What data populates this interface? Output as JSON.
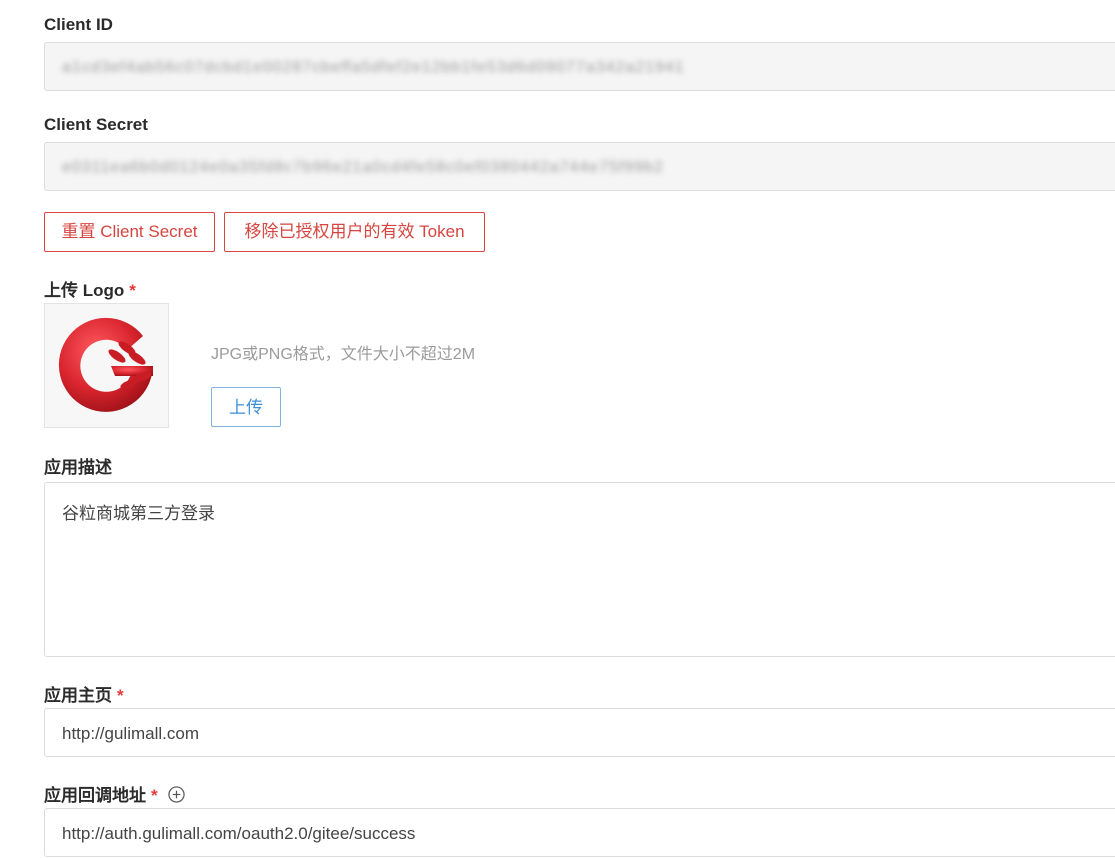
{
  "client_id": {
    "label": "Client ID",
    "value": "a1cd3ef4ab56c07dcbd1e00287cbeffa5dfef2e12bb1fe53d6d09077a342a21941"
  },
  "client_secret": {
    "label": "Client Secret",
    "value": "e0311ea6b0d0124e0a35fd8c7b96e21a0cd4fe58c0ef0380442a744e75f99b2"
  },
  "buttons": {
    "reset_secret": "重置 Client Secret",
    "revoke_tokens": "移除已授权用户的有效 Token"
  },
  "logo": {
    "label": "上传 Logo",
    "required_mark": "*",
    "hint": "JPG或PNG格式，文件大小不超过2M",
    "upload_label": "上传",
    "icon": "gulimall-g-logo",
    "colors": {
      "red": "#d8242d",
      "dark_red": "#a0141c"
    }
  },
  "description": {
    "label": "应用描述",
    "value": "谷粒商城第三方登录"
  },
  "homepage": {
    "label": "应用主页",
    "required_mark": "*",
    "value": "http://gulimall.com"
  },
  "callback": {
    "label": "应用回调地址",
    "required_mark": "*",
    "add_icon": "plus-circle-icon",
    "value": "http://auth.gulimall.com/oauth2.0/gitee/success"
  },
  "colors": {
    "danger": "#d6453f",
    "primary": "#3d8fd6",
    "required": "#e4393c"
  }
}
